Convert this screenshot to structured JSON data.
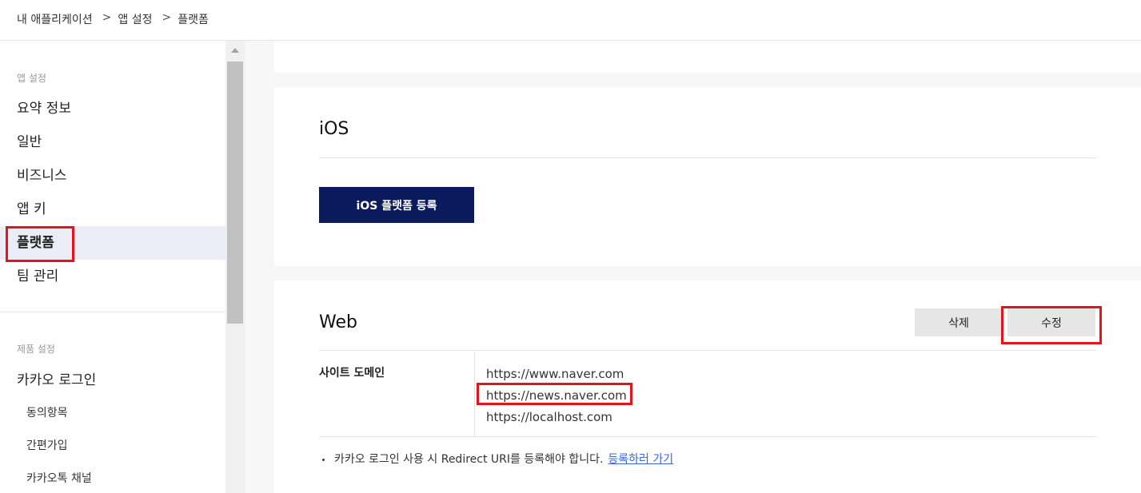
{
  "breadcrumb": {
    "items": [
      "내 애플리케이션",
      "앱 설정",
      "플랫폼"
    ],
    "separator": ">"
  },
  "sidebar": {
    "section_app": "앱 설정",
    "items": [
      "요약 정보",
      "일반",
      "비즈니스",
      "앱 키",
      "플랫폼",
      "팀 관리"
    ],
    "active": "플랫폼",
    "section_product": "제품 설정",
    "product_item": "카카오 로그인",
    "sub_items": [
      "동의항목",
      "간편가입",
      "카카오톡 채널"
    ]
  },
  "ios": {
    "title": "iOS",
    "register_button": "iOS 플랫폼 등록"
  },
  "web": {
    "title": "Web",
    "delete_button": "삭제",
    "edit_button": "수정",
    "site_domain_label": "사이트 도메인",
    "domains": [
      "https://www.naver.com",
      "https://news.naver.com",
      "https://localhost.com"
    ],
    "note": "카카오 로그인 사용 시 Redirect URI를 등록해야 합니다.",
    "note_link": "등록하러 가기"
  },
  "colors": {
    "primary": "#0b1a5c",
    "highlight": "#e3141e",
    "link": "#3b66d8",
    "active_bg": "#eaedf5"
  }
}
